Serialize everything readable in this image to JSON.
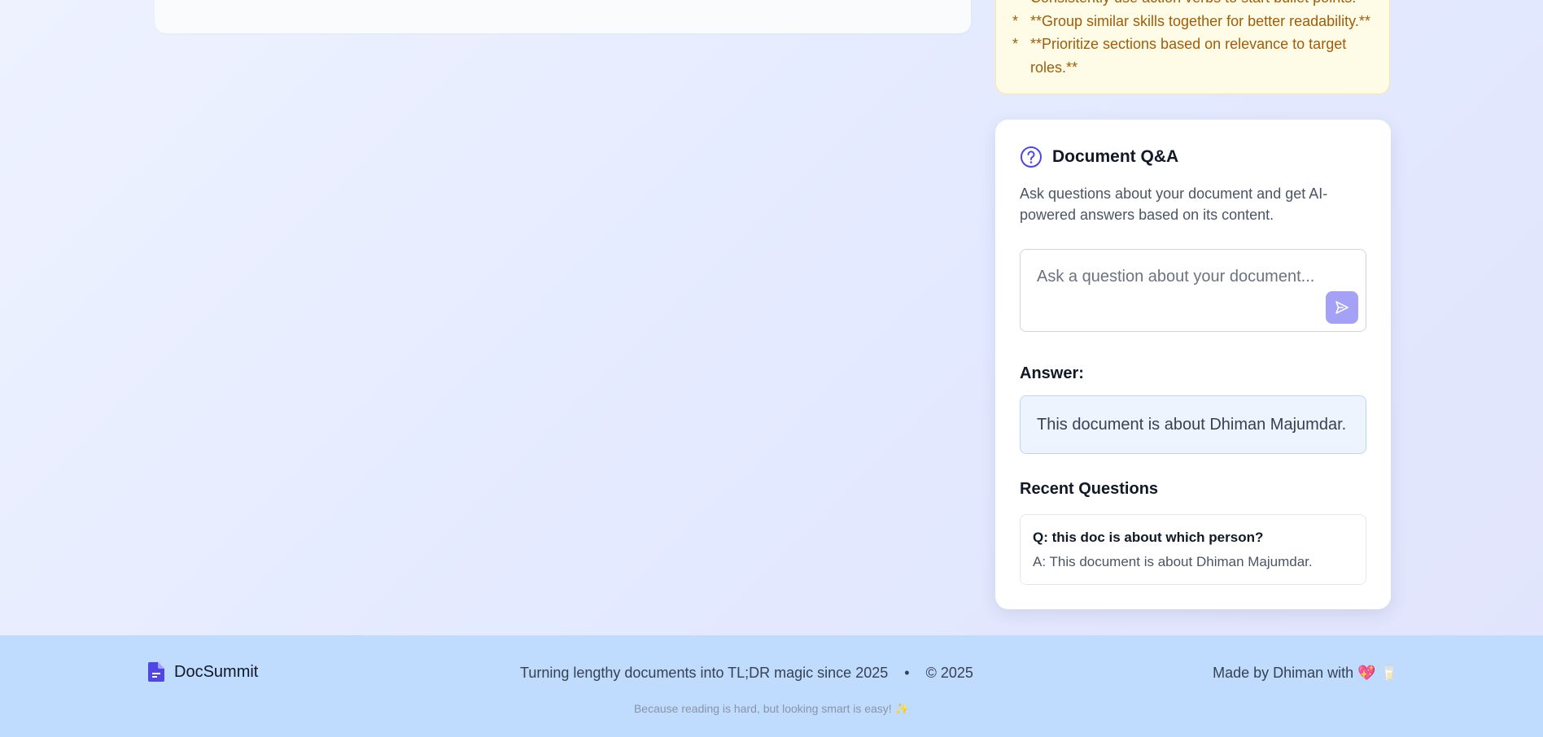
{
  "tips": [
    {
      "bullet": "*",
      "text": "Consistently use action verbs to start bullet points.**"
    },
    {
      "bullet": "*",
      "text": "**Group similar skills together for better readability.**"
    },
    {
      "bullet": "*",
      "text": "**Prioritize sections based on relevance to target roles.**"
    }
  ],
  "qa": {
    "icon": "question-circle-icon",
    "title": "Document Q&A",
    "description": "Ask questions about your document and get AI-powered answers based on its content.",
    "input_placeholder": "Ask a question about your document...",
    "input_value": "",
    "send_icon": "send-icon",
    "answer_label": "Answer:",
    "answer_text": "This document is about Dhiman Majumdar.",
    "recent_label": "Recent Questions",
    "recent": [
      {
        "q": "Q: this doc is about which person?",
        "a": "A: This document is about Dhiman Majumdar."
      }
    ]
  },
  "footer": {
    "brand_icon": "document-icon",
    "brand": "DocSummit",
    "tagline": "Turning lengthy documents into TL;DR magic since 2025",
    "separator": "•",
    "copyright": "© 2025",
    "made_by": "Made by Dhiman with 💖 🥛",
    "sub_tagline": "Because reading is hard, but looking smart is easy! ✨"
  },
  "colors": {
    "accent": "#4f46e5",
    "send_button": "#a5a1f7",
    "tips_text": "#a15c09",
    "footer_bg": "#bfdbfe"
  }
}
